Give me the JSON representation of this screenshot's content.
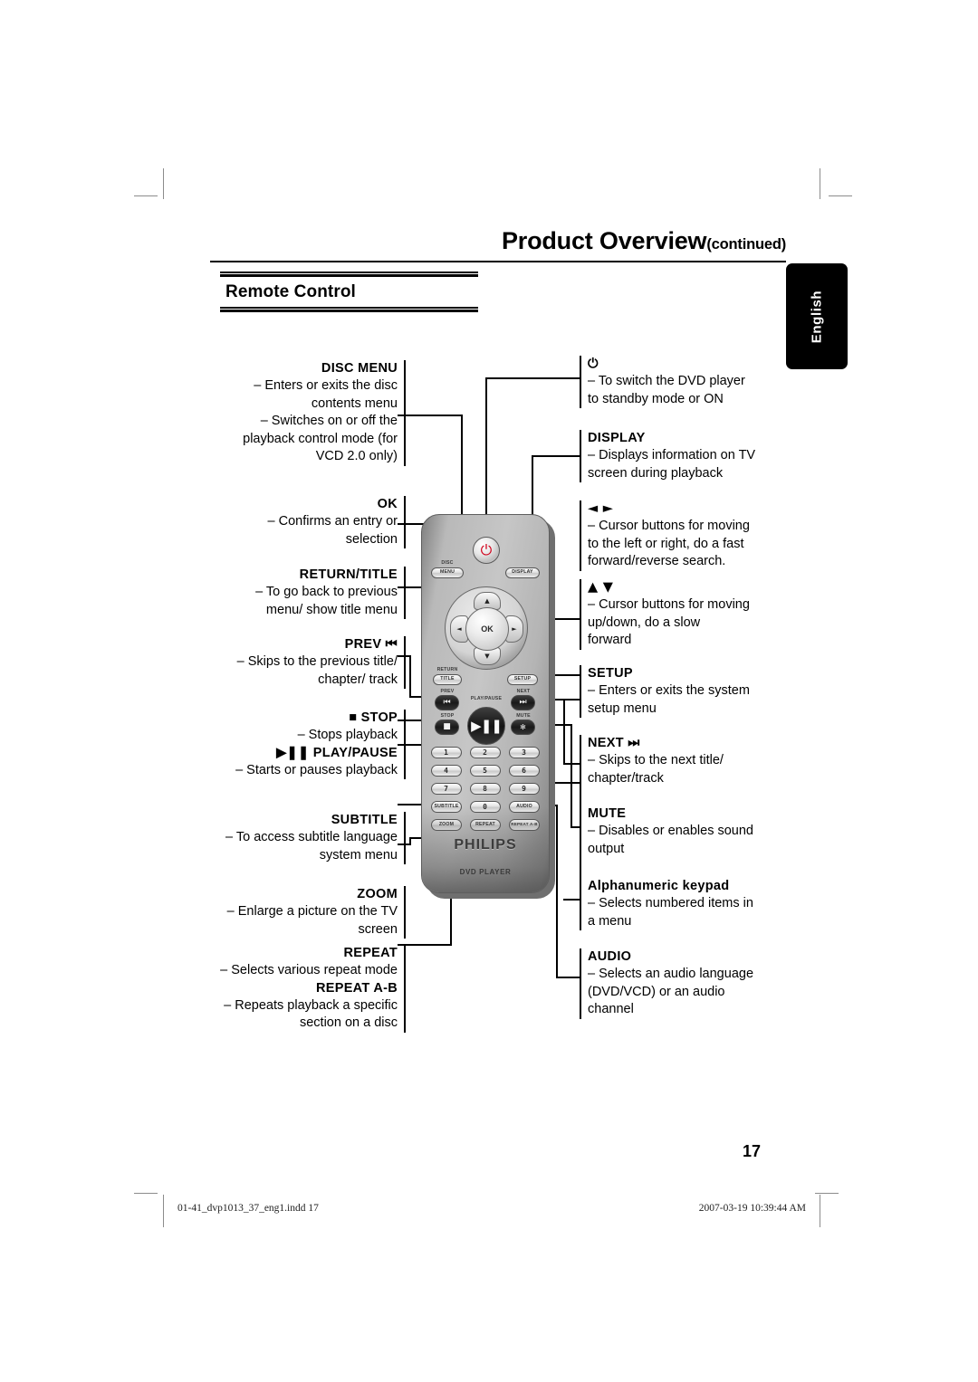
{
  "header": {
    "title": "Product Overview",
    "title_suffix": "(continued)",
    "section_title": "Remote Control",
    "language_tab": "English"
  },
  "remote": {
    "brand": "PHILIPS",
    "sub_brand": "DVD PLAYER",
    "power_glyph": "⏻",
    "disc_label_top": "DISC",
    "disc_menu_btn": "MENU",
    "display_btn": "DISPLAY",
    "nav_up": "▲",
    "nav_down": "▼",
    "nav_left": "◄",
    "nav_right": "►",
    "ok_btn": "OK",
    "return_label_top": "RETURN",
    "title_btn": "TITLE",
    "setup_btn": "SETUP",
    "prev_label": "PREV",
    "prev_glyph": "⏮",
    "next_label": "NEXT",
    "next_glyph": "⏭",
    "playpause_label": "PLAY/PAUSE",
    "playpause_glyph": "▶❚❚",
    "stop_label": "STOP",
    "stop_glyph": "■",
    "mute_label": "MUTE",
    "mute_glyph": "🔇",
    "keypad": [
      "1",
      "2",
      "3",
      "4",
      "5",
      "6",
      "7",
      "8",
      "9"
    ],
    "subtitle_btn": "SUBTITLE",
    "zero_btn": "0",
    "audio_btn": "AUDIO",
    "zoom_btn": "ZOOM",
    "repeat_btn": "REPEAT",
    "repeat_ab_btn": "REPEAT A-B"
  },
  "callouts_left": [
    {
      "heading": "DISC MENU",
      "lines": [
        "– Enters or exits the disc",
        "contents menu",
        "– Switches on or off the",
        "playback control mode (for",
        "VCD 2.0 only)"
      ]
    },
    {
      "heading": "OK",
      "lines": [
        "– Confirms an entry or",
        "selection"
      ]
    },
    {
      "heading": "RETURN/TITLE",
      "lines": [
        "– To go back to previous",
        "menu/ show title menu"
      ]
    },
    {
      "heading": "PREV ⏮",
      "lines": [
        "– Skips to the previous title/",
        "chapter/ track"
      ]
    },
    {
      "heading": "■ STOP",
      "lines": [
        "– Stops playback"
      ]
    },
    {
      "heading": "▶❚❚ PLAY/PAUSE",
      "lines": [
        "– Starts or pauses playback"
      ]
    },
    {
      "heading": "SUBTITLE",
      "lines": [
        "– To access subtitle language",
        "system menu"
      ]
    },
    {
      "heading": "ZOOM",
      "lines": [
        "– Enlarge a picture on the TV",
        "screen"
      ]
    },
    {
      "heading": "REPEAT",
      "lines": [
        "– Selects various repeat mode"
      ]
    },
    {
      "heading": "REPEAT A-B",
      "lines": [
        "– Repeats playback a specific",
        "section on a disc"
      ]
    }
  ],
  "callouts_right": [
    {
      "heading": "⏻",
      "lines": [
        "– To switch the DVD player",
        "to standby mode or ON"
      ]
    },
    {
      "heading": "DISPLAY",
      "lines": [
        "– Displays information on TV",
        "screen during playback"
      ]
    },
    {
      "heading": "◄ ►",
      "lines": [
        "– Cursor buttons for moving",
        "to the left or right, do a fast",
        "forward/reverse search."
      ]
    },
    {
      "heading": "▲ ▼",
      "lines": [
        "– Cursor buttons for moving",
        "up/down, do a slow",
        "forward"
      ]
    },
    {
      "heading": "SETUP",
      "lines": [
        "– Enters or exits the system",
        "setup menu"
      ]
    },
    {
      "heading": "NEXT ⏭",
      "lines": [
        "– Skips to the next title/",
        "chapter/track"
      ]
    },
    {
      "heading": "MUTE",
      "lines": [
        "– Disables or enables sound",
        "output"
      ]
    },
    {
      "heading": "Alphanumeric keypad",
      "lines": [
        "– Selects numbered items in",
        "a menu"
      ]
    },
    {
      "heading": "AUDIO",
      "lines": [
        "– Selects an audio language",
        "(DVD/VCD) or an audio",
        "channel"
      ]
    }
  ],
  "footer": {
    "page_number": "17",
    "file_name": "01-41_dvp1013_37_eng1.indd   17",
    "timestamp": "2007-03-19   10:39:44 AM"
  }
}
